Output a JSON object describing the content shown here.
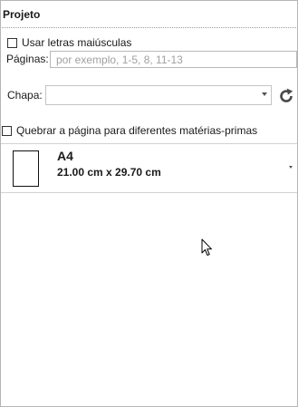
{
  "section": {
    "title": "Projeto"
  },
  "uppercase_option": {
    "label": "Usar letras maiúsculas",
    "checked": false
  },
  "pages": {
    "label": "Páginas:",
    "value": "",
    "placeholder": "por exemplo, 1-5, 8, 11-13"
  },
  "sheet": {
    "label": "Chapa:",
    "selected_value": "",
    "refresh_icon": "refresh-icon",
    "dropdown_icon": "chevron-down-icon"
  },
  "break_option": {
    "label": "Quebrar a página para diferentes matérias-primas",
    "checked": false
  },
  "paper": {
    "name": "A4",
    "dimensions": "21.00 cm x 29.70 cm",
    "icon": "page-icon",
    "dropdown_icon": "chevron-down-icon"
  },
  "colors": {
    "refresh_icon": "#4a4a4a",
    "border": "#b5b5b5"
  }
}
